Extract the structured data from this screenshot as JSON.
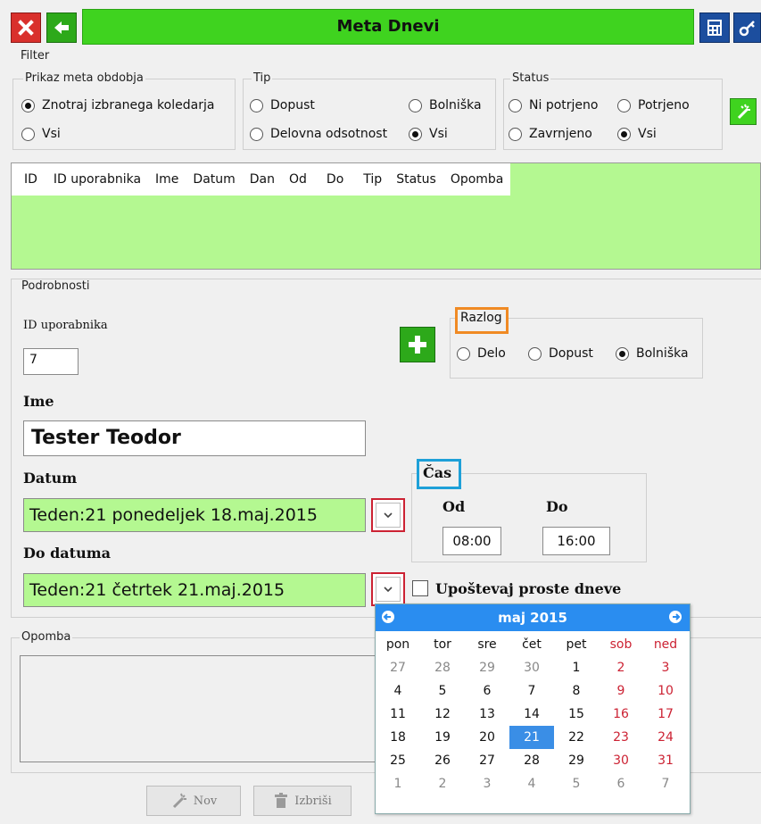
{
  "window": {
    "title": "Meta Dnevi"
  },
  "filter": {
    "legend": "Filter",
    "period": {
      "legend": "Prikaz meta obdobja",
      "options": [
        "Znotraj izbranega koledarja",
        "Vsi"
      ],
      "selected": "Znotraj izbranega koledarja"
    },
    "type": {
      "legend": "Tip",
      "options": [
        "Dopust",
        "Bolniška",
        "Delovna odsotnost",
        "Vsi"
      ],
      "selected": "Vsi"
    },
    "status": {
      "legend": "Status",
      "options": [
        "Ni potrjeno",
        "Potrjeno",
        "Zavrnjeno",
        "Vsi"
      ],
      "selected": "Vsi"
    }
  },
  "table": {
    "columns": [
      "ID",
      "ID uporabnika",
      "Ime",
      "Datum",
      "Dan",
      "Od",
      "Do",
      "Tip",
      "Status",
      "Opomba"
    ],
    "rows": []
  },
  "details": {
    "legend": "Podrobnosti",
    "user_id_label": "ID uporabnika",
    "user_id_value": "7",
    "reason": {
      "legend": "Razlog",
      "options": [
        "Delo",
        "Dopust",
        "Bolniška"
      ],
      "selected": "Bolniška"
    },
    "name_label": "Ime",
    "name_value": "Tester Teodor",
    "date_label": "Datum",
    "date_value": "Teden:21 ponedeljek 18.maj.2015",
    "to_date_label": "Do datuma",
    "to_date_value": "Teden:21 četrtek 21.maj.2015",
    "time": {
      "legend": "Čas",
      "from_label": "Od",
      "from_value": "08:00",
      "to_label": "Do",
      "to_value": "16:00"
    },
    "consider_free_days_label": "Upoštevaj proste dneve",
    "consider_free_days_checked": false
  },
  "note": {
    "legend": "Opomba",
    "value": ""
  },
  "calendar": {
    "month_label": "maj 2015",
    "weekdays": [
      "pon",
      "tor",
      "sre",
      "čet",
      "pet",
      "sob",
      "ned"
    ],
    "weeks": [
      [
        "27",
        "28",
        "29",
        "30",
        "1",
        "2",
        "3"
      ],
      [
        "4",
        "5",
        "6",
        "7",
        "8",
        "9",
        "10"
      ],
      [
        "11",
        "12",
        "13",
        "14",
        "15",
        "16",
        "17"
      ],
      [
        "18",
        "19",
        "20",
        "21",
        "22",
        "23",
        "24"
      ],
      [
        "25",
        "26",
        "27",
        "28",
        "29",
        "30",
        "31"
      ],
      [
        "1",
        "2",
        "3",
        "4",
        "5",
        "6",
        "7"
      ]
    ],
    "selected_day": "21"
  },
  "buttons": {
    "new_label": "Nov",
    "delete_label": "Izbriši"
  },
  "colors": {
    "accent_green": "#3fd31f",
    "grid_green": "#b4f891",
    "calendar_blue": "#2a8df0",
    "weekend_red": "#cc2233",
    "highlight_orange": "#f08a24",
    "highlight_cyan": "#1ea0d8"
  }
}
